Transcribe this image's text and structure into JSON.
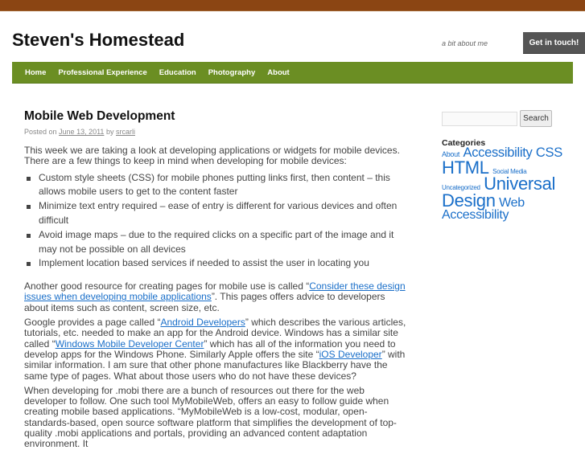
{
  "site": {
    "title": "Steven's Homestead",
    "tagline": "a bit about me",
    "cta": "Get in touch!"
  },
  "nav": [
    "Home",
    "Professional Experience",
    "Education",
    "Photography",
    "About"
  ],
  "post": {
    "title": "Mobile Web Development",
    "meta_prefix": "Posted on",
    "date": "June 13, 2011",
    "meta_by": "by",
    "author": "srcarli",
    "intro": "This week we are taking a look at developing applications or widgets for mobile devices. There are a few things to keep in mind when developing for mobile devices:",
    "list": [
      "Custom style sheets (CSS) for mobile phones putting links first, then content – this allows mobile users to get to the content faster",
      "Minimize text entry required – ease of entry is different for various devices and often difficult",
      "Avoid image maps – due to the required clicks on a specific part of the image and it may not be possible on all devices",
      "Implement location based services if needed to assist the user in locating you"
    ],
    "p2": {
      "a": "Another good resource for creating pages for mobile use is called “",
      "link": "Consider these design issues when developing mobile applications",
      "b": "”. This pages offers advice to developers about items such as content, screen size, etc."
    },
    "p3": {
      "a": "Google provides a page called “",
      "link1": "Android Developers",
      "b": "” which describes the various articles, tutorials, etc. needed to make an app for the Android device. Windows has a similar site called “",
      "link2": "Windows Mobile Developer Center",
      "c": "” which has all of the information you need to develop apps for the Windows Phone. Similarly Apple offers the site “",
      "link3": "iOS Developer",
      "d": "” with similar information. I am sure that other phone manufactures like Blackberry have the same type of pages. What about those users who do not have these devices?"
    },
    "p4": "When developing for .mobi there are a bunch of resources out there for the web developer to follow. One such tool MyMobileWeb, offers an easy to follow guide when creating mobile based applications. “MyMobileWeb is a low-cost, modular, open-standards-based, open source software platform that simplifies the development of top-quality .mobi applications and portals, providing an advanced content adaptation environment. It"
  },
  "sidebar": {
    "search_button": "Search",
    "search_value": "",
    "categories_title": "Categories",
    "categories": [
      "About",
      "Accessibility",
      "CSS",
      "HTML",
      "Social Media",
      "Uncategorized",
      "Universal Design",
      "Web Accessibility"
    ]
  },
  "colors": {
    "topbar": "#8b4513",
    "nav": "#6b8e23",
    "link": "#1a6fc9",
    "cta": "#555555"
  }
}
